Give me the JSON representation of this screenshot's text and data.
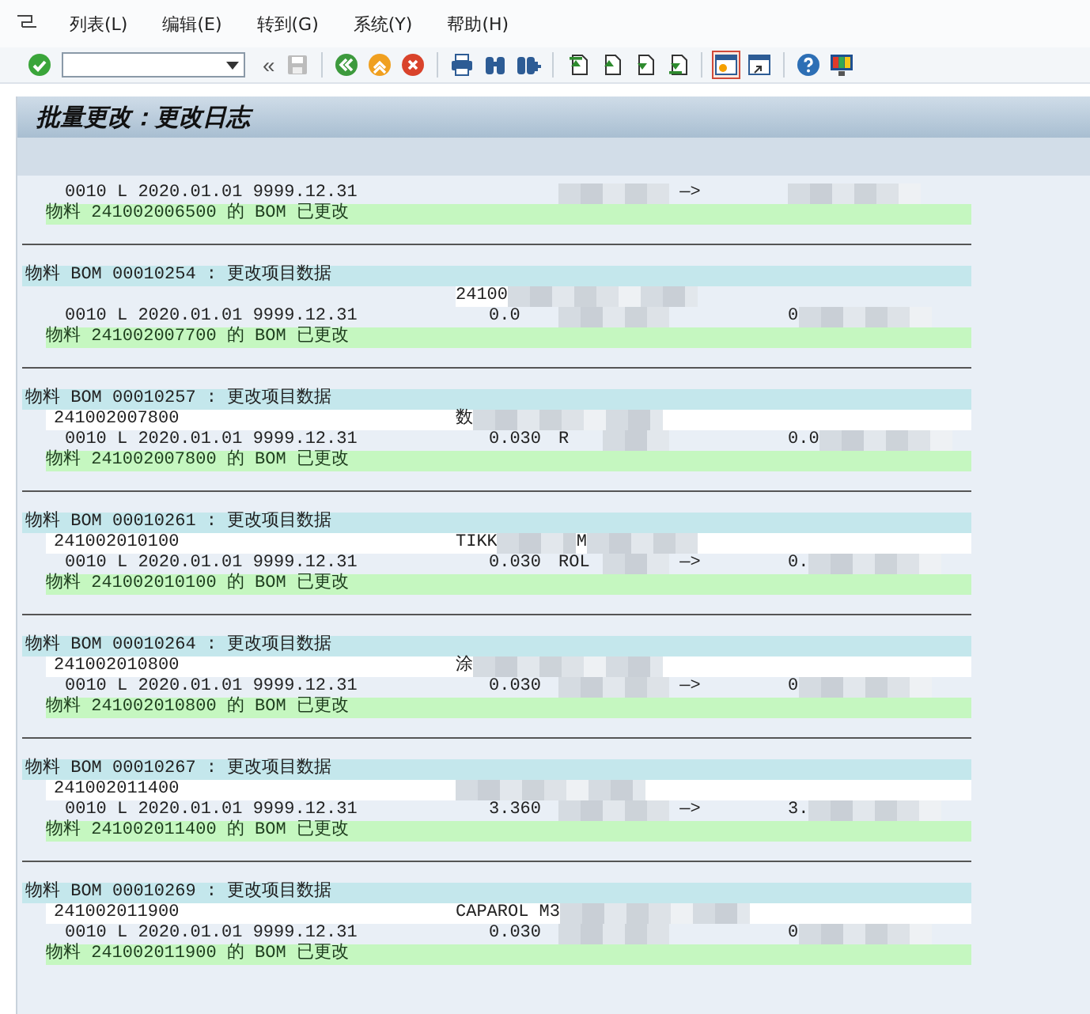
{
  "menu": [
    {
      "label": "列表(L)"
    },
    {
      "label": "编辑(E)"
    },
    {
      "label": "转到(G)"
    },
    {
      "label": "系统(Y)"
    },
    {
      "label": "帮助(H)"
    }
  ],
  "toolbar": [
    {
      "kind": "enter"
    },
    {
      "kind": "command"
    },
    {
      "kind": "collapse",
      "text": "«"
    },
    {
      "kind": "save",
      "disabled": true
    },
    {
      "kind": "sep"
    },
    {
      "kind": "back"
    },
    {
      "kind": "exit"
    },
    {
      "kind": "cancel"
    },
    {
      "kind": "sep"
    },
    {
      "kind": "print"
    },
    {
      "kind": "find"
    },
    {
      "kind": "findnext"
    },
    {
      "kind": "sep"
    },
    {
      "kind": "first"
    },
    {
      "kind": "prev"
    },
    {
      "kind": "next"
    },
    {
      "kind": "last"
    },
    {
      "kind": "sep"
    },
    {
      "kind": "session",
      "highlighted": true
    },
    {
      "kind": "shortcut"
    },
    {
      "kind": "sep"
    },
    {
      "kind": "help"
    },
    {
      "kind": "layout"
    }
  ],
  "title": "批量更改：更改日志",
  "log": [
    {
      "item": {
        "dates": "0010 L 2020.01.01 9999.12.31",
        "arrow": "—>"
      },
      "message": "物料 241002006500 的 BOM 已更改"
    },
    {
      "header": "物料 BOM 00010254 : 更改项目数据",
      "material": {
        "description": "24100"
      },
      "item": {
        "dates": "0010 L 2020.01.01 9999.12.31",
        "old_qty": "0.0",
        "new_qty": "0"
      },
      "message": "物料 241002007700 的 BOM 已更改"
    },
    {
      "header": "物料 BOM 00010257 : 更改项目数据",
      "material": {
        "number": "241002007800",
        "description": "数"
      },
      "item": {
        "dates": "0010 L 2020.01.01 9999.12.31",
        "old_qty": "0.030",
        "unit": "R",
        "new_qty": "0.0"
      },
      "message": "物料 241002007800 的 BOM 已更改"
    },
    {
      "header": "物料 BOM 00010261 : 更改项目数据",
      "material": {
        "number": "241002010100",
        "description": "TIKK",
        "extra": "M"
      },
      "item": {
        "dates": "0010 L 2020.01.01 9999.12.31",
        "old_qty": "0.030",
        "unit": "ROL",
        "arrow": "—>",
        "new_qty": "0."
      },
      "message": "物料 241002010100 的 BOM 已更改"
    },
    {
      "header": "物料 BOM 00010264 : 更改项目数据",
      "material": {
        "number": "241002010800",
        "description": "涂"
      },
      "item": {
        "dates": "0010 L 2020.01.01 9999.12.31",
        "old_qty": "0.030",
        "arrow": "—>",
        "new_qty": "0"
      },
      "message": "物料 241002010800 的 BOM 已更改"
    },
    {
      "header": "物料 BOM 00010267 : 更改项目数据",
      "material": {
        "number": "241002011400"
      },
      "item": {
        "dates": "0010 L 2020.01.01 9999.12.31",
        "old_qty": "3.360",
        "arrow": "—>",
        "new_qty": "3."
      },
      "message": "物料 241002011400 的 BOM 已更改"
    },
    {
      "header": "物料 BOM 00010269 : 更改项目数据",
      "material": {
        "number": "241002011900",
        "description": "CAPAROL M3"
      },
      "item": {
        "dates": "0010 L 2020.01.01 9999.12.31",
        "old_qty": "0.030",
        "new_qty": "0"
      },
      "message": "物料 241002011900 的 BOM 已更改"
    }
  ]
}
